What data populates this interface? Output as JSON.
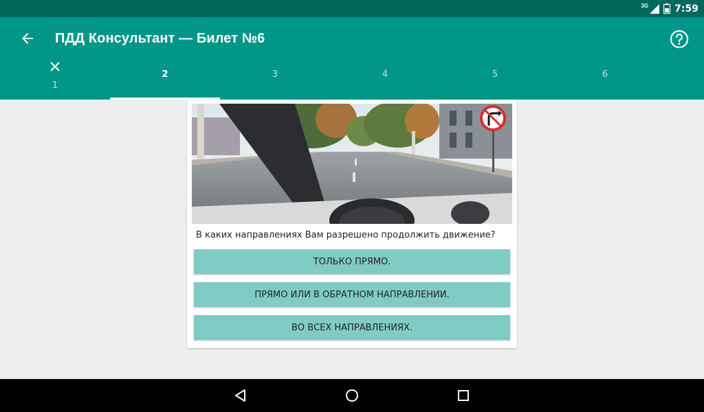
{
  "status_bar": {
    "network": "3G",
    "time": "7:59"
  },
  "app_bar": {
    "title": "ПДД Консультант — Билет №6"
  },
  "tabs": [
    {
      "label": "1",
      "answered_icon": "close-icon"
    },
    {
      "label": "2"
    },
    {
      "label": "3"
    },
    {
      "label": "4"
    },
    {
      "label": "5"
    },
    {
      "label": "6"
    }
  ],
  "active_tab": 1,
  "question": {
    "image_sign": "no-right-turn-sign",
    "text": "В каких направлениях Вам разрешено продолжить движение?",
    "answers": [
      "ТОЛЬКО ПРЯМО.",
      "ПРЯМО ИЛИ В ОБРАТНОМ НАПРАВЛЕНИИ.",
      "ВО ВСЕХ НАПРАВЛЕНИЯХ."
    ]
  },
  "colors": {
    "primary": "#009688",
    "primary_dark": "#00695c",
    "answer_bg": "#80cbc4"
  }
}
